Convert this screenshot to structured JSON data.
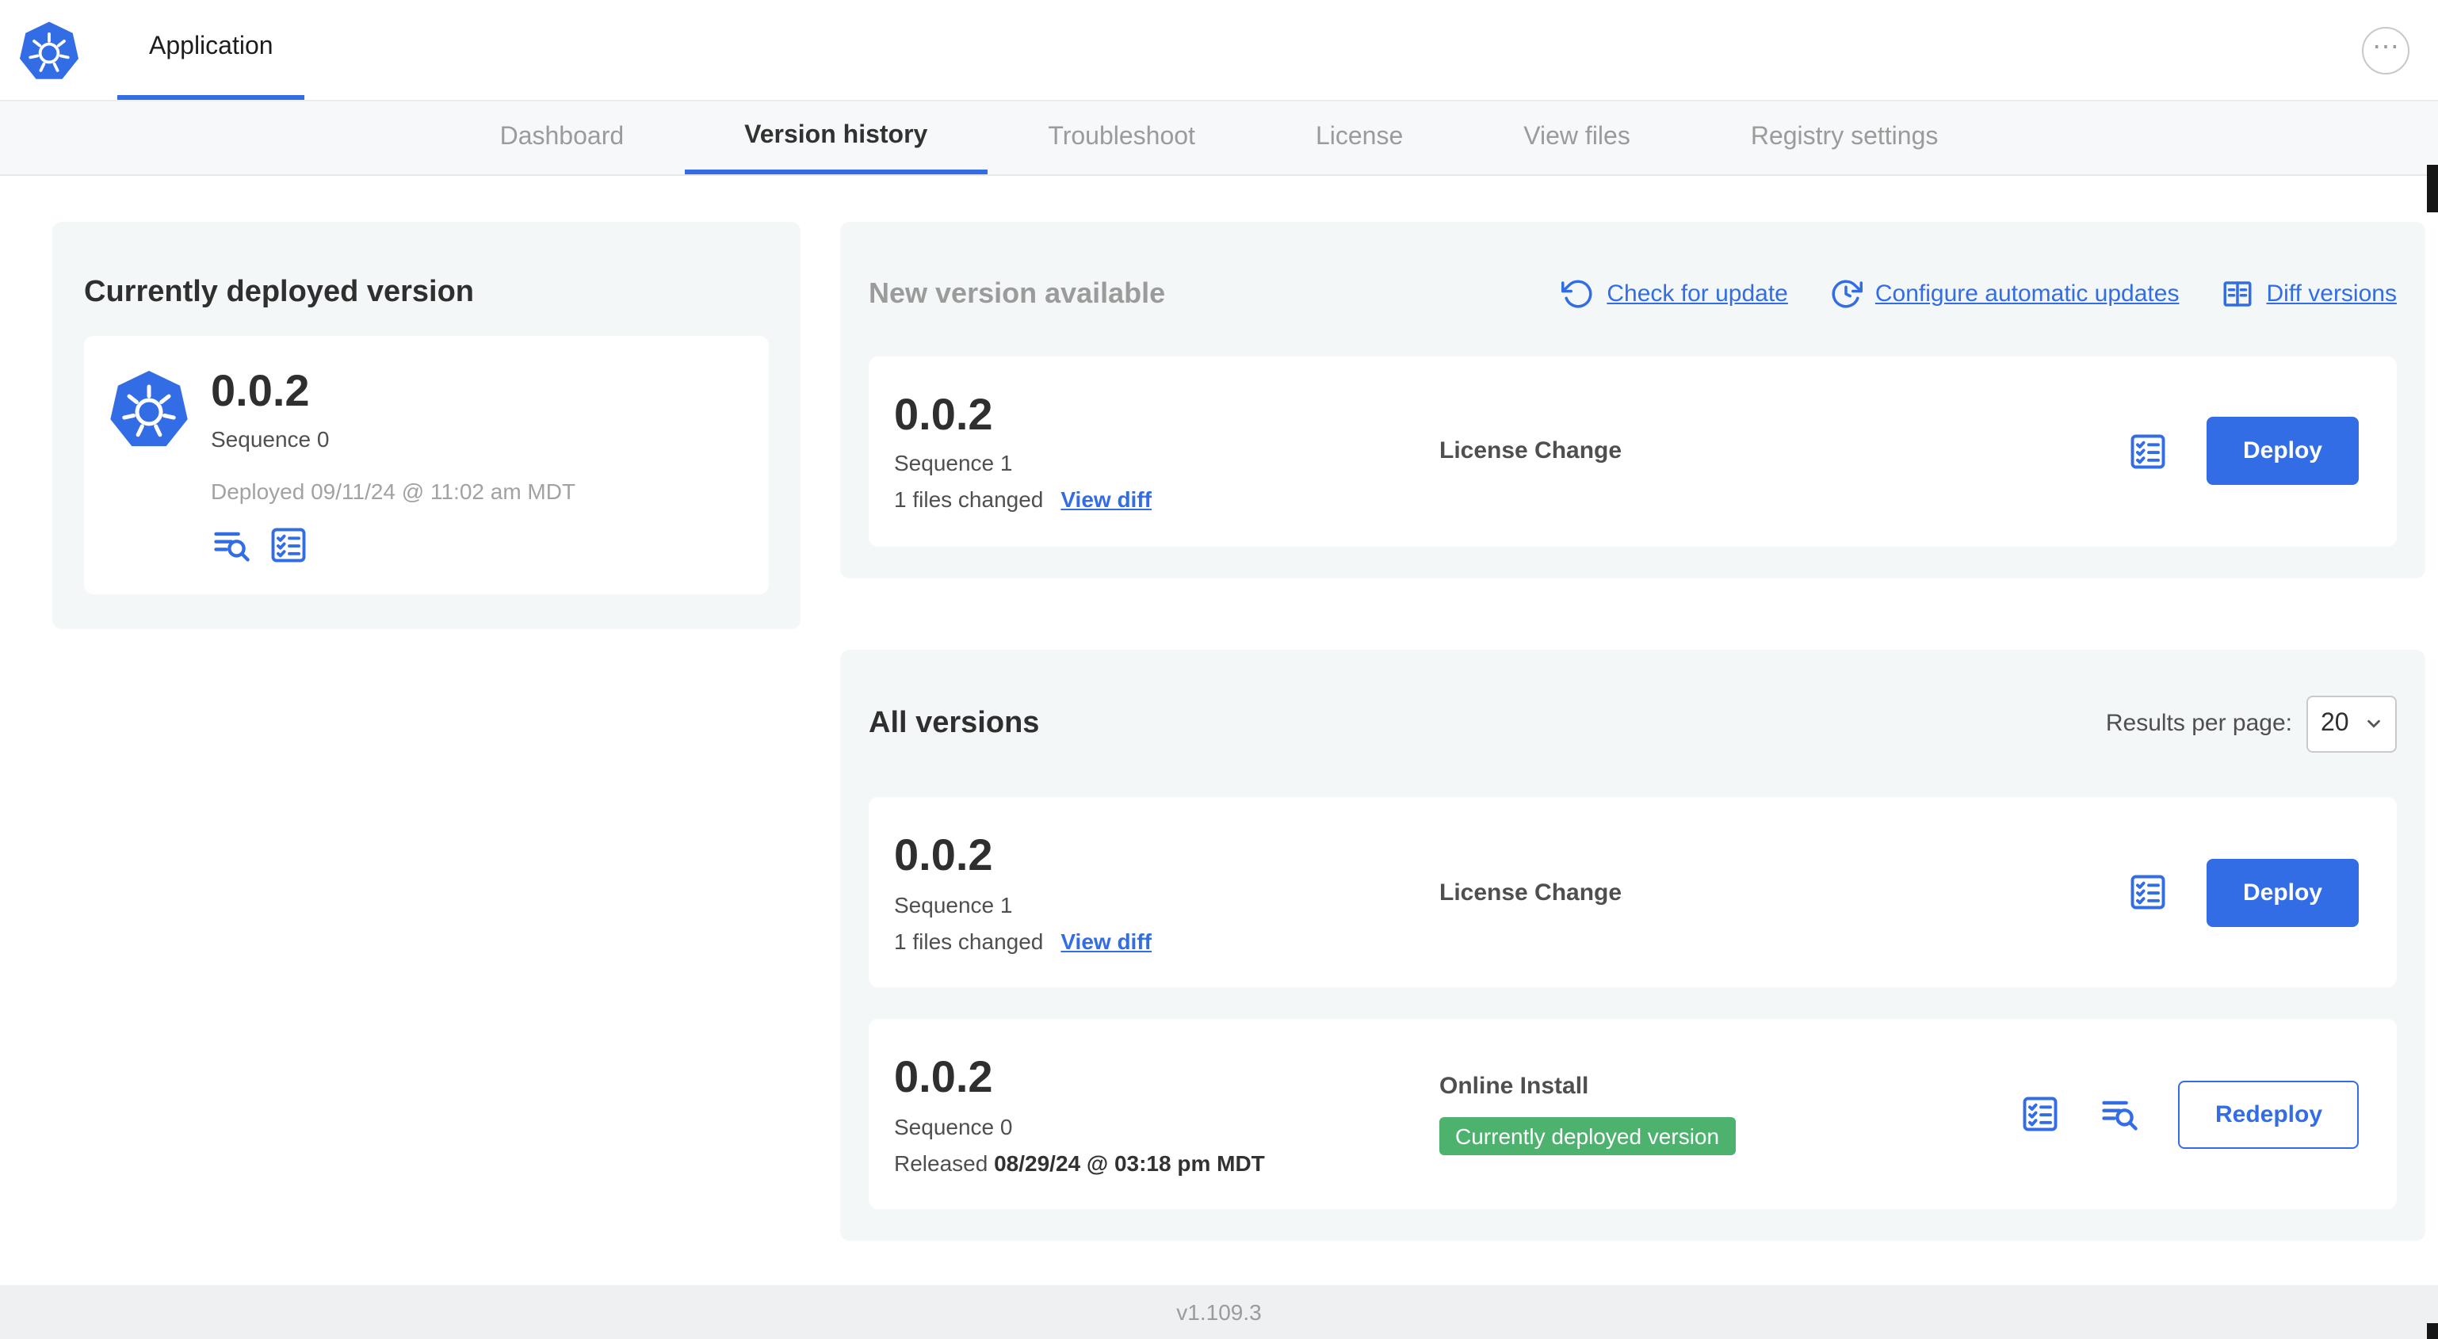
{
  "colors": {
    "accent": "#326de6",
    "badge_green": "#4cb26e",
    "card_bg": "#f4f7f8",
    "muted_text": "#9b9b9b"
  },
  "header": {
    "title": "Application",
    "more_icon": "⋯"
  },
  "nav": {
    "tabs": [
      {
        "label": "Dashboard"
      },
      {
        "label": "Version history"
      },
      {
        "label": "Troubleshoot"
      },
      {
        "label": "License"
      },
      {
        "label": "View files"
      },
      {
        "label": "Registry settings"
      }
    ]
  },
  "current": {
    "title": "Currently deployed version",
    "version": "0.0.2",
    "sequence": "Sequence 0",
    "deployed": "Deployed 09/11/24 @ 11:02 am MDT"
  },
  "new_version": {
    "title": "New version available",
    "check_for_update": "Check for update",
    "configure_updates": "Configure automatic updates",
    "diff_versions": "Diff versions",
    "row": {
      "version": "0.0.2",
      "sequence": "Sequence 1",
      "files_changed": "1 files changed",
      "view_diff": "View diff",
      "source": "License Change",
      "action": "Deploy"
    }
  },
  "all_versions": {
    "title": "All versions",
    "results_label": "Results per page:",
    "results_value": "20",
    "rows": [
      {
        "version": "0.0.2",
        "sequence": "Sequence 1",
        "files_changed": "1 files changed",
        "view_diff": "View diff",
        "source": "License Change",
        "action": "Deploy"
      },
      {
        "version": "0.0.2",
        "sequence": "Sequence 0",
        "released_label": "Released",
        "released_date": "08/29/24 @ 03:18 pm MDT",
        "source": "Online Install",
        "badge": "Currently deployed version",
        "action": "Redeploy"
      }
    ]
  },
  "footer": {
    "version": "v1.109.3"
  }
}
